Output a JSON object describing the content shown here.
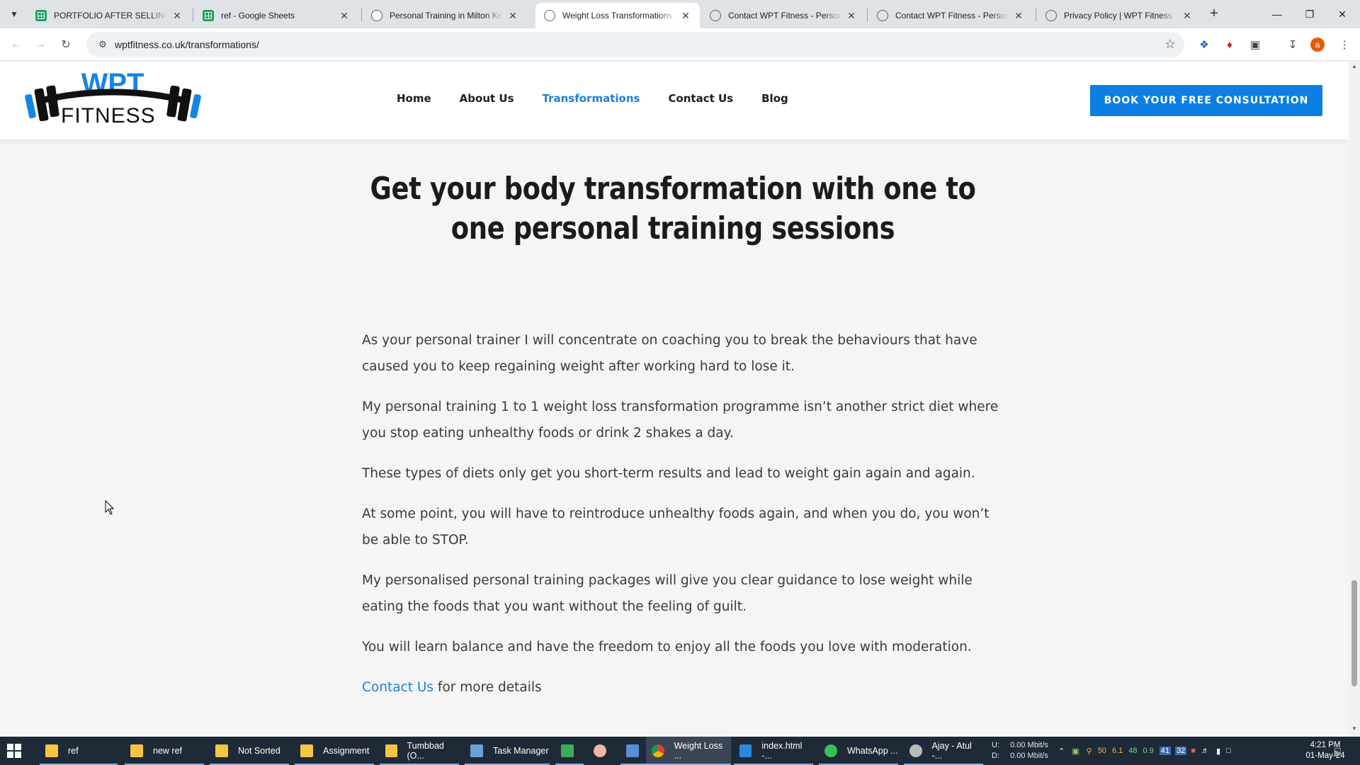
{
  "browser": {
    "tabs": [
      {
        "title": "PORTFOLIO AFTER SELLING - G",
        "icon": "sheets-icon"
      },
      {
        "title": "ref - Google Sheets",
        "icon": "sheets-icon"
      },
      {
        "title": "Personal Training in Milton Key",
        "icon": "wpt-icon"
      },
      {
        "title": "Weight Loss Transformations | S",
        "icon": "globe-icon"
      },
      {
        "title": "Contact WPT Fitness - Personal",
        "icon": "globe-icon"
      },
      {
        "title": "Contact WPT Fitness - Personal",
        "icon": "globe-icon"
      },
      {
        "title": "Privacy Policy | WPT Fitness",
        "icon": "globe-icon"
      }
    ],
    "active_tab_index": 3,
    "url": "wptfitness.co.uk/transformations/"
  },
  "site": {
    "logo_text": "WPT",
    "logo_subtext": "FITNESS",
    "nav": [
      {
        "label": "Home",
        "current": false
      },
      {
        "label": "About Us",
        "current": false
      },
      {
        "label": "Transformations",
        "current": true
      },
      {
        "label": "Contact Us",
        "current": false
      },
      {
        "label": "Blog",
        "current": false
      }
    ],
    "cta_label": "BOOK YOUR FREE CONSULTATION",
    "accent_color": "#0d7fe3"
  },
  "content": {
    "headline": "Get your body transformation with one to one personal training sessions",
    "paragraphs": [
      "As your personal trainer I will concentrate on coaching you to break the behaviours that have caused you to keep regaining weight after working hard to lose it.",
      "My personal training 1 to 1 weight loss transformation programme isn’t another strict diet where you stop eating unhealthy foods or drink 2 shakes a day.",
      "These types of diets only get you short-term results and lead to weight gain again and again.",
      "At some point, you will have to reintroduce unhealthy foods again, and when you do, you won’t be able to STOP.",
      "My personalised personal training packages will give you clear guidance to lose weight while eating the foods that you want without the feeling of guilt.",
      "You will learn balance and have the freedom to enjoy all the foods you love with moderation."
    ],
    "contact_link": "Contact Us",
    "contact_suffix": " for more details"
  },
  "taskbar": {
    "items": [
      {
        "label": "ref",
        "icon": "folder"
      },
      {
        "label": "new ref",
        "icon": "folder"
      },
      {
        "label": "Not Sorted",
        "icon": "folder"
      },
      {
        "label": "Assignment",
        "icon": "folder"
      },
      {
        "label": "Tumbbad (O...",
        "icon": "folder"
      },
      {
        "label": "Task Manager",
        "icon": "taskmgr"
      },
      {
        "label": "",
        "icon": "green"
      },
      {
        "label": "",
        "icon": "pig"
      },
      {
        "label": "",
        "icon": "doc"
      },
      {
        "label": "Weight Loss ...",
        "icon": "chrome"
      },
      {
        "label": "index.html -...",
        "icon": "vscode"
      },
      {
        "label": "WhatsApp ...",
        "icon": "whatsapp"
      },
      {
        "label": "Ajay - Atul -...",
        "icon": "ajay"
      }
    ],
    "net_up_label": "U:",
    "net_down_label": "D:",
    "net_up": "0.00 Mbit/s",
    "net_down": "0.00 Mbit/s",
    "tray_values": [
      "50",
      "6.1",
      "48",
      "0.9",
      "41",
      "32"
    ],
    "time": "4:21 PM",
    "date": "01-May-24",
    "notification_count": "5"
  }
}
